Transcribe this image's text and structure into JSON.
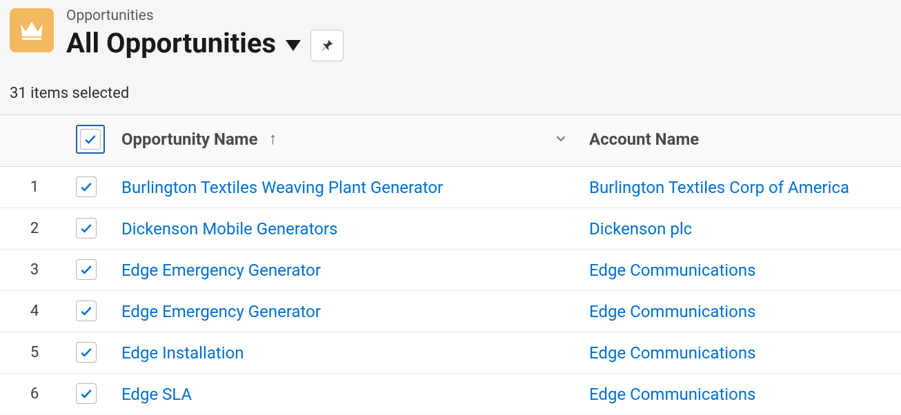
{
  "header": {
    "object_label": "Opportunities",
    "view_title": "All Opportunities",
    "selection_status": "31 items selected"
  },
  "columns": {
    "opportunity_name": "Opportunity Name",
    "account_name": "Account Name",
    "sort_dir": "asc"
  },
  "rows": [
    {
      "num": "1",
      "checked": true,
      "opportunity": "Burlington Textiles Weaving Plant Generator",
      "account": "Burlington Textiles Corp of America"
    },
    {
      "num": "2",
      "checked": true,
      "opportunity": "Dickenson Mobile Generators",
      "account": "Dickenson plc"
    },
    {
      "num": "3",
      "checked": true,
      "opportunity": "Edge Emergency Generator",
      "account": "Edge Communications"
    },
    {
      "num": "4",
      "checked": true,
      "opportunity": "Edge Emergency Generator",
      "account": "Edge Communications"
    },
    {
      "num": "5",
      "checked": true,
      "opportunity": "Edge Installation",
      "account": "Edge Communications"
    },
    {
      "num": "6",
      "checked": true,
      "opportunity": "Edge SLA",
      "account": "Edge Communications"
    }
  ],
  "select_all_checked": true
}
